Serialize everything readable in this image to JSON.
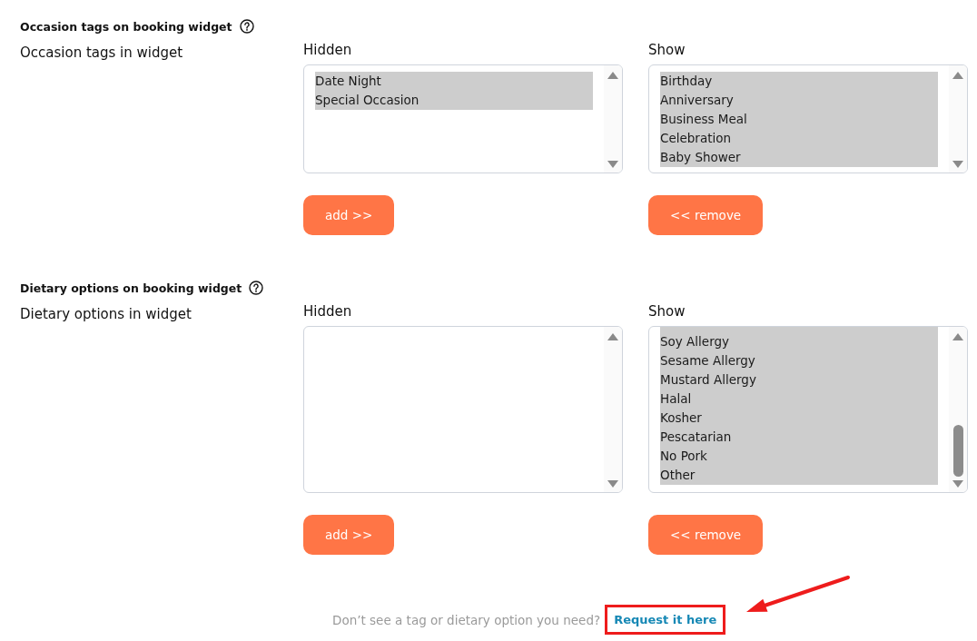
{
  "sections": [
    {
      "title": "Occasion tags on booking widget",
      "field_label": "Occasion tags in widget",
      "hidden": {
        "label": "Hidden",
        "scrolled": false,
        "options": [
          {
            "text": "Date Night",
            "selected": true
          },
          {
            "text": "Special Occasion",
            "selected": true
          }
        ]
      },
      "show": {
        "label": "Show",
        "scrolled": false,
        "options": [
          {
            "text": "Birthday",
            "selected": true
          },
          {
            "text": "Anniversary",
            "selected": true
          },
          {
            "text": "Business Meal",
            "selected": true
          },
          {
            "text": "Celebration",
            "selected": true
          },
          {
            "text": "Baby Shower",
            "selected": true
          }
        ]
      },
      "add_button": "add >>",
      "remove_button": "<< remove"
    },
    {
      "title": "Dietary options on booking widget",
      "field_label": "Dietary options in widget",
      "hidden": {
        "label": "Hidden",
        "scrolled": false
      },
      "show": {
        "label": "Show",
        "scrolled": true,
        "options": [
          {
            "text": "Soy Allergy",
            "selected": true
          },
          {
            "text": "Sesame Allergy",
            "selected": true
          },
          {
            "text": "Mustard Allergy",
            "selected": true
          },
          {
            "text": "Halal",
            "selected": true
          },
          {
            "text": "Kosher",
            "selected": true
          },
          {
            "text": "Pescatarian",
            "selected": true
          },
          {
            "text": "No Pork",
            "selected": true
          },
          {
            "text": "Other",
            "selected": true
          }
        ]
      },
      "add_button": "add >>",
      "remove_button": "<< remove"
    }
  ],
  "footer": {
    "text": "Don’t see a tag or dietary option you need?",
    "link": {
      "text": "Request it here",
      "highlighted": true
    }
  }
}
